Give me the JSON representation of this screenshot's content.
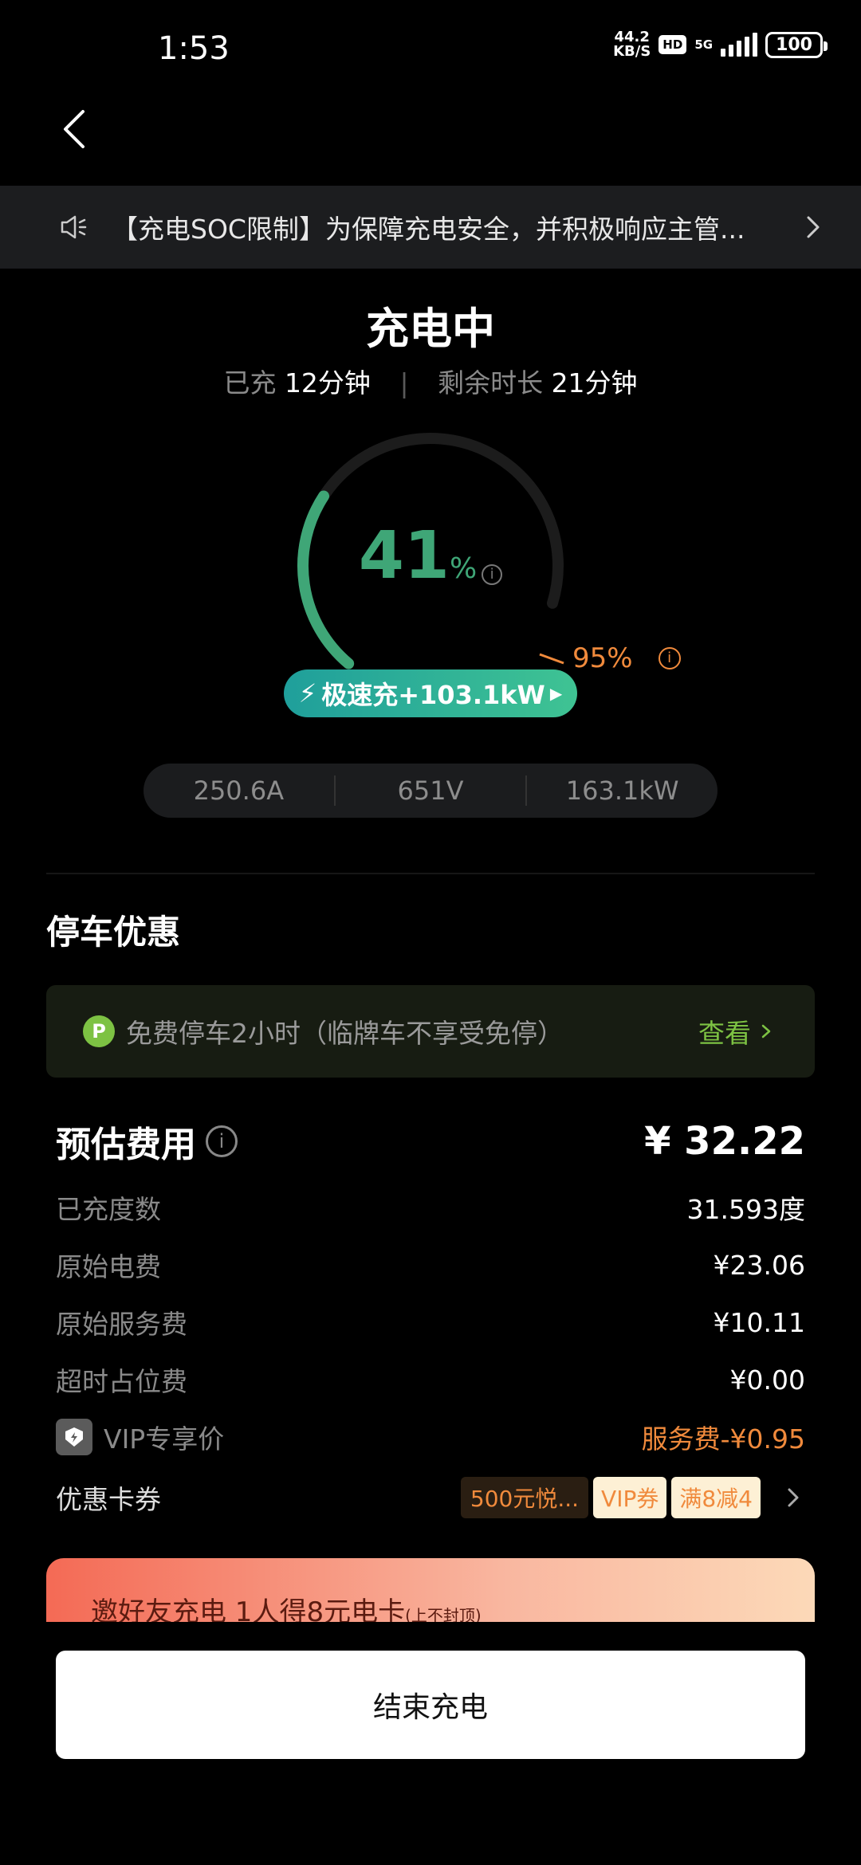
{
  "status_bar": {
    "time": "1:53",
    "speed_value": "44.2",
    "speed_unit": "KB/S",
    "hd": "HD",
    "network": "5G",
    "battery": "100"
  },
  "notice": {
    "text": "【充电SOC限制】为保障充电安全，并积极响应主管..."
  },
  "charging": {
    "status_title": "充电中",
    "charged_label": "已充",
    "charged_value": "12分钟",
    "remaining_label": "剩余时长",
    "remaining_value": "21分钟",
    "percent": "41",
    "percent_sign": "%",
    "soc_fraction": 0.41,
    "limit_label": "95%",
    "limit_fraction": 0.95,
    "mode_label": "极速充+103.1kW",
    "current": "250.6A",
    "voltage": "651V",
    "power": "163.1kW"
  },
  "parking": {
    "title": "停车优惠",
    "p_icon": "P",
    "text": "免费停车2小时（临牌车不享受免停）",
    "link": "查看"
  },
  "fees": {
    "title": "预估费用",
    "total": "¥ 32.22",
    "rows": [
      {
        "label": "已充度数",
        "value": "31.593度"
      },
      {
        "label": "原始电费",
        "value": "¥23.06"
      },
      {
        "label": "原始服务费",
        "value": "¥10.11"
      },
      {
        "label": "超时占位费",
        "value": "¥0.00"
      }
    ],
    "vip_label": "VIP专享价",
    "vip_value": "服务费-¥0.95",
    "coupon_label": "优惠卡券",
    "coupon_tags": [
      "500元悦...",
      "VIP券",
      "满8减4"
    ]
  },
  "banner": {
    "text": "邀好友充电 1人得8元电卡",
    "small": "(上不封顶)"
  },
  "end_button": "结束充电",
  "colors": {
    "accent_green": "#3fa677",
    "accent_orange": "#f08a3c",
    "park_green": "#7dc243"
  }
}
